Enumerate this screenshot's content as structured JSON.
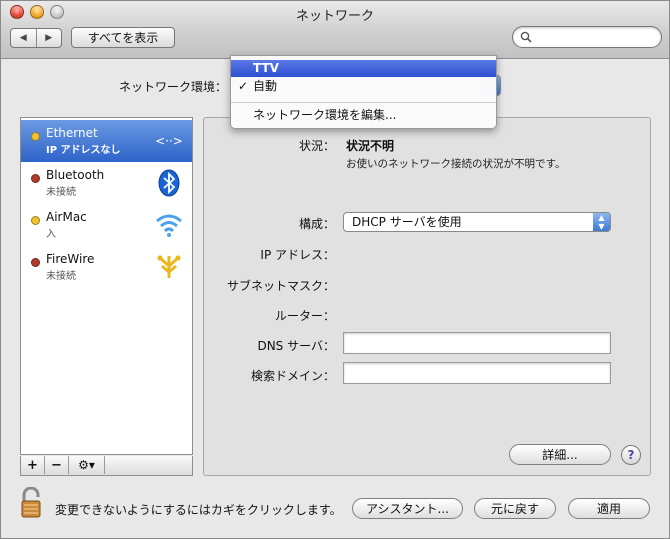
{
  "window": {
    "title": "ネットワーク"
  },
  "toolbar": {
    "back_label": "◀",
    "forward_label": "▶",
    "show_all_label": "すべてを表示",
    "search_placeholder": ""
  },
  "location": {
    "label": "ネットワーク環境：",
    "menu": {
      "highlighted": "TTV",
      "current": "自動",
      "check_mark": "✓",
      "edit": "ネットワーク環境を編集..."
    }
  },
  "services": [
    {
      "name": "Ethernet",
      "status": "IP アドレスなし",
      "dot_color": "#f2c12e",
      "icon": "ethernet-icon",
      "active": true
    },
    {
      "name": "Bluetooth",
      "status": "未接続",
      "dot_color": "#b23a2a",
      "icon": "bluetooth-icon",
      "active": false
    },
    {
      "name": "AirMac",
      "status": "入",
      "dot_color": "#f2c12e",
      "icon": "wifi-icon",
      "active": false
    },
    {
      "name": "FireWire",
      "status": "未接続",
      "dot_color": "#b23a2a",
      "icon": "firewire-icon",
      "active": false
    }
  ],
  "service_list_buttons": {
    "add": "+",
    "remove": "−",
    "gear": "⚙▾"
  },
  "details": {
    "status_label": "状況：",
    "status_value": "状況不明",
    "status_description": "お使いのネットワーク接続の状況が不明です。",
    "config_label": "構成：",
    "config_value": "DHCP サーバを使用",
    "ip_label": "IP アドレス：",
    "subnet_label": "サブネットマスク：",
    "router_label": "ルーター：",
    "dns_label": "DNS サーバ：",
    "dns_value": "",
    "search_domain_label": "検索ドメイン：",
    "search_domain_value": "",
    "advanced_button": "詳細...",
    "help_button": "?"
  },
  "footer": {
    "lock_text": "変更できないようにするにはカギをクリックします。",
    "assist_button": "アシスタント...",
    "revert_button": "元に戻す",
    "apply_button": "適用"
  },
  "colors": {
    "selection": "#2e63c9",
    "menu_highlight": "#2e4fd1",
    "help_glyph": "#5b3fa8"
  }
}
